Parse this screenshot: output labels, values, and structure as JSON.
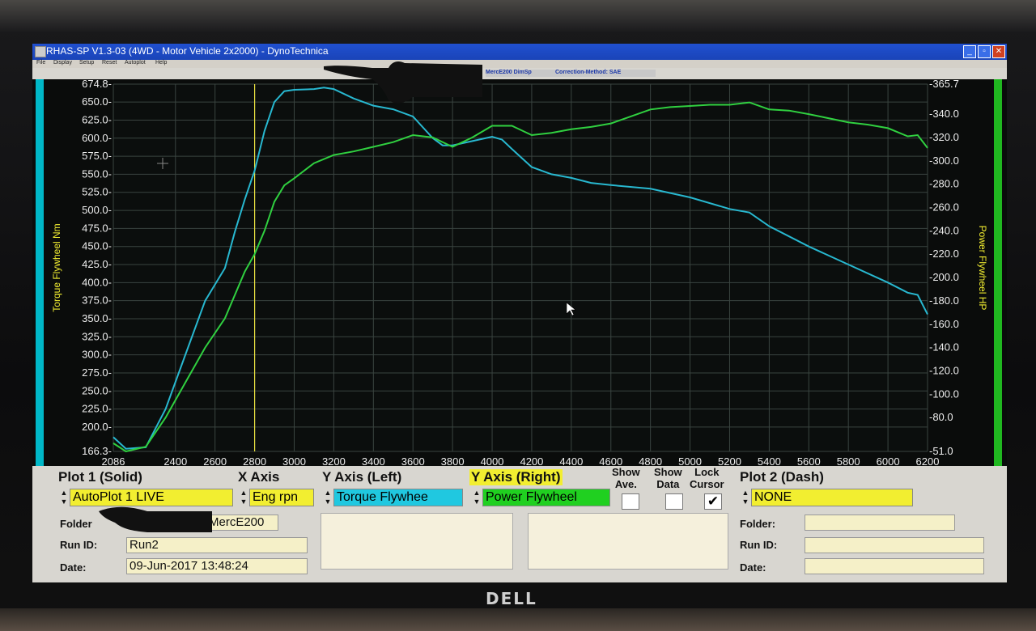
{
  "window": {
    "title": "RHAS-SP V1.3-03  (4WD - Motor Vehicle 2x2000) - DynoTechnica",
    "menu": [
      "File",
      "Display",
      "Setup",
      "Reset",
      "Autoplot",
      "Help"
    ],
    "info": [
      "MercE200 DimSp",
      "Correction-Method: SAE"
    ]
  },
  "monitor_brand": "DELL",
  "chart_data": {
    "type": "line",
    "x_ticks": [
      "2086",
      "2400",
      "2600",
      "2800",
      "3000",
      "3200",
      "3400",
      "3600",
      "3800",
      "4000",
      "4200",
      "4400",
      "4600",
      "4800",
      "5000",
      "5200",
      "5400",
      "5600",
      "5800",
      "6000",
      "6200"
    ],
    "x_range": [
      2086,
      6200
    ],
    "y_left_ticks": [
      "674.8-",
      "650.0-",
      "625.0-",
      "600.0-",
      "575.0-",
      "550.0-",
      "525.0-",
      "500.0-",
      "475.0-",
      "450.0-",
      "425.0-",
      "400.0-",
      "375.0-",
      "350.0-",
      "325.0-",
      "300.0-",
      "275.0-",
      "250.0-",
      "225.0-",
      "200.0-",
      "166.3-"
    ],
    "y_left_range": [
      166.3,
      674.8
    ],
    "y_right_ticks": [
      "-365.7",
      "-340.0",
      "-320.0",
      "-300.0",
      "-280.0",
      "-260.0",
      "-240.0",
      "-220.0",
      "-200.0",
      "-180.0",
      "-160.0",
      "-140.0",
      "-120.0",
      "-100.0",
      "-80.0",
      "-51.0"
    ],
    "y_right_range": [
      51.0,
      365.7
    ],
    "ylabel_left": "Torque Flywheel Nm",
    "ylabel_right": "Power Flywheel HP",
    "cursor_x": 2800,
    "series": [
      {
        "name": "Torque Flywheel",
        "axis": "left",
        "color": "#28b8d0",
        "x": [
          2086,
          2150,
          2250,
          2350,
          2450,
          2550,
          2650,
          2700,
          2750,
          2800,
          2850,
          2900,
          2950,
          3000,
          3100,
          3150,
          3200,
          3300,
          3400,
          3500,
          3600,
          3700,
          3750,
          3800,
          3900,
          4000,
          4050,
          4100,
          4200,
          4300,
          4400,
          4500,
          4600,
          4800,
          5000,
          5200,
          5300,
          5400,
          5600,
          5800,
          6000,
          6100,
          6150,
          6200
        ],
        "y": [
          186,
          170,
          172,
          225,
          300,
          375,
          420,
          470,
          515,
          555,
          610,
          650,
          665,
          667,
          668,
          670,
          668,
          655,
          645,
          640,
          630,
          600,
          590,
          590,
          596,
          602,
          598,
          585,
          560,
          550,
          545,
          538,
          535,
          530,
          518,
          502,
          497,
          478,
          450,
          425,
          400,
          386,
          383,
          356
        ]
      },
      {
        "name": "Power Flywheel",
        "axis": "right",
        "color": "#30d040",
        "x": [
          2086,
          2150,
          2250,
          2350,
          2450,
          2550,
          2650,
          2750,
          2800,
          2850,
          2900,
          2950,
          3000,
          3100,
          3200,
          3300,
          3400,
          3500,
          3600,
          3700,
          3800,
          3900,
          4000,
          4100,
          4200,
          4300,
          4400,
          4500,
          4600,
          4800,
          4900,
          5000,
          5100,
          5200,
          5300,
          5400,
          5500,
          5600,
          5800,
          5900,
          6000,
          6100,
          6150,
          6200
        ],
        "y": [
          58,
          51,
          55,
          80,
          110,
          140,
          165,
          205,
          220,
          240,
          265,
          279,
          285,
          298,
          305,
          308,
          312,
          316,
          322,
          320,
          312,
          320,
          330,
          330,
          322,
          324,
          327,
          329,
          332,
          344,
          346,
          347,
          348,
          348,
          350,
          344,
          343,
          340,
          333,
          331,
          328,
          321,
          322,
          311
        ]
      }
    ]
  },
  "plot1": {
    "label": "Plot 1 (Solid)",
    "source": "AutoPlot 1 LIVE",
    "folder_label": "Folder",
    "folder_value": "MercE200",
    "runid_label": "Run ID:",
    "runid_value": "Run2",
    "date_label": "Date:",
    "date_value": "09-Jun-2017  13:48:24"
  },
  "xaxis": {
    "label": "X Axis",
    "value": "Eng rpn",
    "color": "#f2ee30"
  },
  "yleft": {
    "label": "Y Axis (Left)",
    "value": "Torque Flywhee",
    "color": "#20c8e0"
  },
  "yright": {
    "label": "Y Axis (Right)",
    "value": "Power Flywheel",
    "color": "#20d020",
    "label_bg": "#f2ee30"
  },
  "toggles": {
    "show_ave": "Show\nAve.",
    "show_ave_l1": "Show",
    "show_ave_l2": "Ave.",
    "show_data_l1": "Show",
    "show_data_l2": "Data",
    "lock_cursor_l1": "Lock",
    "lock_cursor_l2": "Cursor",
    "show_ave_checked": false,
    "show_data_checked": false,
    "lock_cursor_checked": true
  },
  "plot2": {
    "label": "Plot 2 (Dash)",
    "source": "NONE",
    "folder_label": "Folder:",
    "runid_label": "Run ID:",
    "date_label": "Date:"
  }
}
